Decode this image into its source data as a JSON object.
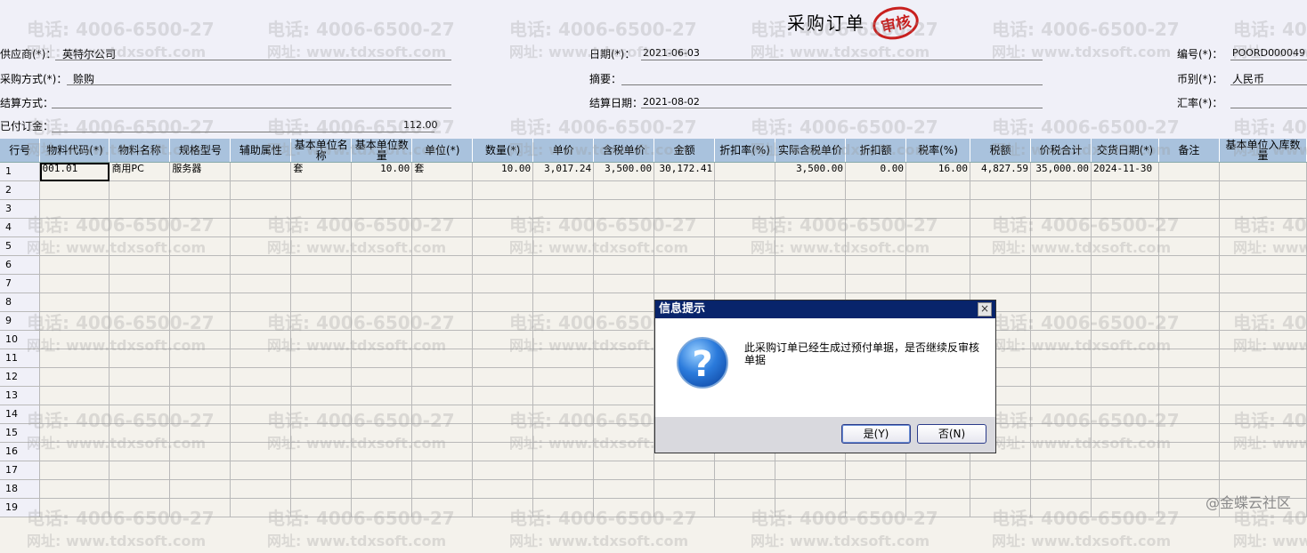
{
  "header": {
    "title": "采购订单",
    "stamp": "审核",
    "fields": {
      "supplier": {
        "label": "供应商(*)：",
        "value": "英特尔公司"
      },
      "purchase_method": {
        "label": "采购方式(*)：",
        "value": "赊购"
      },
      "settlement_method": {
        "label": "结算方式：",
        "value": ""
      },
      "prepaid": {
        "label": "已付订金：",
        "value": "112.00"
      },
      "date": {
        "label": "日期(*)：",
        "value": "2021-06-03"
      },
      "summary": {
        "label": "摘要：",
        "value": ""
      },
      "settlement_date": {
        "label": "结算日期：",
        "value": "2021-08-02"
      },
      "number": {
        "label": "编号(*)：",
        "value": "POORD000049"
      },
      "currency": {
        "label": "币别(*)：",
        "value": "人民币"
      },
      "exchange_rate": {
        "label": "汇率(*)：",
        "value": ""
      }
    }
  },
  "table": {
    "columns": [
      "行号",
      "物料代码(*)",
      "物料名称",
      "规格型号",
      "辅助属性",
      "基本单位名称",
      "基本单位数量",
      "单位(*)",
      "数量(*)",
      "单价",
      "含税单价",
      "金额",
      "折扣率(%)",
      "实际含税单价",
      "折扣额",
      "税率(%)",
      "税额",
      "价税合计",
      "交货日期(*)",
      "备注",
      "基本单位入库数量"
    ],
    "rows": [
      [
        "1",
        "001.01",
        "商用PC",
        "服务器",
        "",
        "套",
        "10.00",
        "套",
        "10.00",
        "3,017.24",
        "3,500.00",
        "30,172.41",
        "",
        "3,500.00",
        "0.00",
        "16.00",
        "4,827.59",
        "35,000.00",
        "2024-11-30",
        "",
        ""
      ],
      [
        "2",
        "",
        "",
        "",
        "",
        "",
        "",
        "",
        "",
        "",
        "",
        "",
        "",
        "",
        "",
        "",
        "",
        "",
        "",
        "",
        ""
      ],
      [
        "3",
        "",
        "",
        "",
        "",
        "",
        "",
        "",
        "",
        "",
        "",
        "",
        "",
        "",
        "",
        "",
        "",
        "",
        "",
        "",
        ""
      ],
      [
        "4",
        "",
        "",
        "",
        "",
        "",
        "",
        "",
        "",
        "",
        "",
        "",
        "",
        "",
        "",
        "",
        "",
        "",
        "",
        "",
        ""
      ],
      [
        "5",
        "",
        "",
        "",
        "",
        "",
        "",
        "",
        "",
        "",
        "",
        "",
        "",
        "",
        "",
        "",
        "",
        "",
        "",
        "",
        ""
      ],
      [
        "6",
        "",
        "",
        "",
        "",
        "",
        "",
        "",
        "",
        "",
        "",
        "",
        "",
        "",
        "",
        "",
        "",
        "",
        "",
        "",
        ""
      ],
      [
        "7",
        "",
        "",
        "",
        "",
        "",
        "",
        "",
        "",
        "",
        "",
        "",
        "",
        "",
        "",
        "",
        "",
        "",
        "",
        "",
        ""
      ],
      [
        "8",
        "",
        "",
        "",
        "",
        "",
        "",
        "",
        "",
        "",
        "",
        "",
        "",
        "",
        "",
        "",
        "",
        "",
        "",
        "",
        ""
      ],
      [
        "9",
        "",
        "",
        "",
        "",
        "",
        "",
        "",
        "",
        "",
        "",
        "",
        "",
        "",
        "",
        "",
        "",
        "",
        "",
        "",
        ""
      ],
      [
        "10",
        "",
        "",
        "",
        "",
        "",
        "",
        "",
        "",
        "",
        "",
        "",
        "",
        "",
        "",
        "",
        "",
        "",
        "",
        "",
        ""
      ],
      [
        "11",
        "",
        "",
        "",
        "",
        "",
        "",
        "",
        "",
        "",
        "",
        "",
        "",
        "",
        "",
        "",
        "",
        "",
        "",
        "",
        ""
      ],
      [
        "12",
        "",
        "",
        "",
        "",
        "",
        "",
        "",
        "",
        "",
        "",
        "",
        "",
        "",
        "",
        "",
        "",
        "",
        "",
        "",
        ""
      ],
      [
        "13",
        "",
        "",
        "",
        "",
        "",
        "",
        "",
        "",
        "",
        "",
        "",
        "",
        "",
        "",
        "",
        "",
        "",
        "",
        "",
        ""
      ],
      [
        "14",
        "",
        "",
        "",
        "",
        "",
        "",
        "",
        "",
        "",
        "",
        "",
        "",
        "",
        "",
        "",
        "",
        "",
        "",
        "",
        ""
      ],
      [
        "15",
        "",
        "",
        "",
        "",
        "",
        "",
        "",
        "",
        "",
        "",
        "",
        "",
        "",
        "",
        "",
        "",
        "",
        "",
        "",
        ""
      ],
      [
        "16",
        "",
        "",
        "",
        "",
        "",
        "",
        "",
        "",
        "",
        "",
        "",
        "",
        "",
        "",
        "",
        "",
        "",
        "",
        "",
        ""
      ],
      [
        "17",
        "",
        "",
        "",
        "",
        "",
        "",
        "",
        "",
        "",
        "",
        "",
        "",
        "",
        "",
        "",
        "",
        "",
        "",
        "",
        ""
      ],
      [
        "18",
        "",
        "",
        "",
        "",
        "",
        "",
        "",
        "",
        "",
        "",
        "",
        "",
        "",
        "",
        "",
        "",
        "",
        "",
        "",
        ""
      ],
      [
        "19",
        "",
        "",
        "",
        "",
        "",
        "",
        "",
        "",
        "",
        "",
        "",
        "",
        "",
        "",
        "",
        "",
        "",
        "",
        "",
        ""
      ]
    ]
  },
  "watermark": {
    "phone": "电话: 4006-6500-27",
    "site": "网址: www.tdxsoft.com"
  },
  "dialog": {
    "title": "信息提示",
    "close": "×",
    "icon": "question-icon",
    "icon_glyph": "?",
    "message": "此采购订单已经生成过预付单据，是否继续反审核单据",
    "yes_label": "是(Y)",
    "no_label": "否(N)"
  },
  "community_label": "@金蝶云社区",
  "colors": {
    "header_bg": "#f0f0f8",
    "column_header_bg": "#a9c2dd",
    "dialog_title_bg": "#08246b",
    "stamp_red": "#c8201f"
  }
}
